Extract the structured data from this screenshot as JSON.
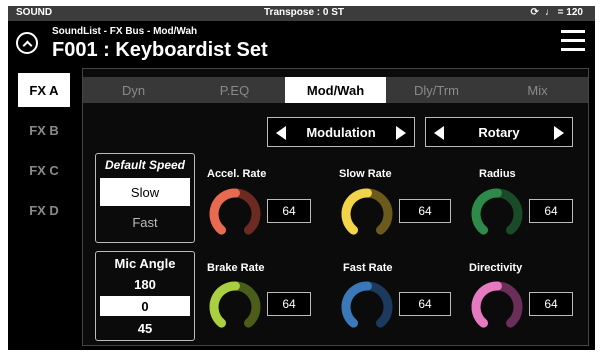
{
  "status": {
    "mode": "SOUND",
    "transpose": "Transpose : 0 ST",
    "tempo_icon": "metronome-icon",
    "tempo": "♩ = 120"
  },
  "header": {
    "path": "SoundList - FX Bus - Mod/Wah",
    "title": "F001 : Keyboardist Set"
  },
  "fx_tabs": [
    "FX A",
    "FX B",
    "FX C",
    "FX D"
  ],
  "top_tabs": [
    "Dyn",
    "P.EQ",
    "Mod/Wah",
    "Dly/Trm",
    "Mix"
  ],
  "selectors": {
    "effect_type": "Modulation",
    "effect_model": "Rotary"
  },
  "speed": {
    "title": "Default Speed",
    "options": [
      "Slow",
      "Fast"
    ],
    "selected": "Slow"
  },
  "mic_angle": {
    "title": "Mic Angle",
    "values": [
      "180",
      "0",
      "45"
    ],
    "selected": "0"
  },
  "knobs": [
    {
      "label": "Accel. Rate",
      "value": "64",
      "color": "#e86a50",
      "track": "#6b2a22"
    },
    {
      "label": "Slow Rate",
      "value": "64",
      "color": "#f2d44a",
      "track": "#6a5a1c"
    },
    {
      "label": "Radius",
      "value": "64",
      "color": "#2e8a4a",
      "track": "#1a4a28"
    },
    {
      "label": "Brake Rate",
      "value": "64",
      "color": "#a8d040",
      "track": "#4a5e1a"
    },
    {
      "label": "Fast Rate",
      "value": "64",
      "color": "#3a78b8",
      "track": "#1c3a5e"
    },
    {
      "label": "Directivity",
      "value": "64",
      "color": "#e67ac0",
      "track": "#6a2e58"
    }
  ]
}
